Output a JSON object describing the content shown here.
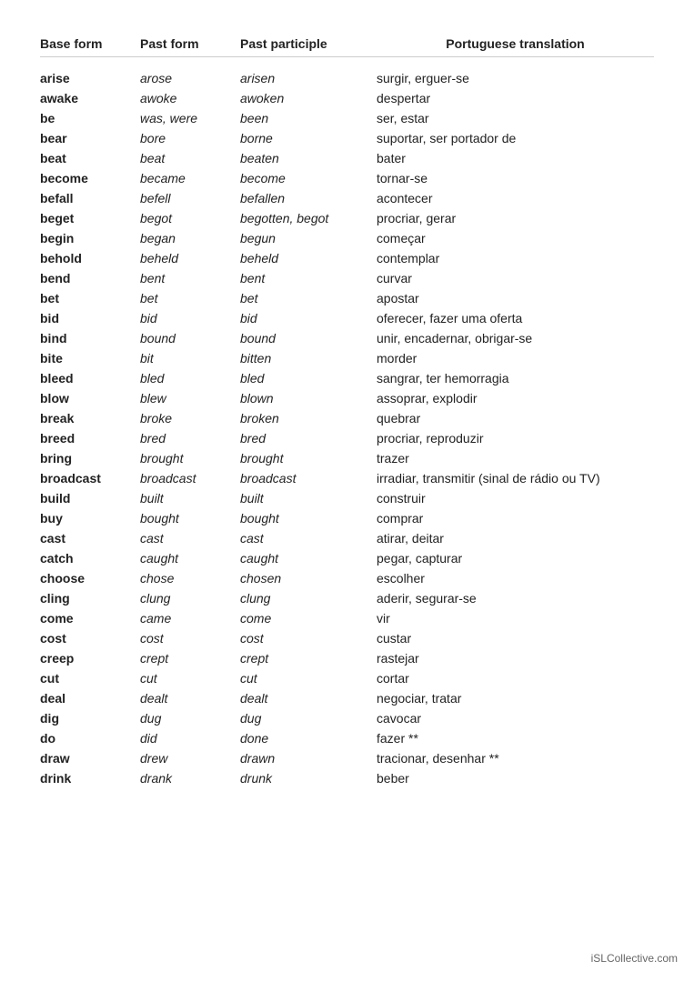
{
  "headers": {
    "base": "Base form",
    "past": "Past form",
    "pp": "Past participle",
    "pt": "Portuguese translation"
  },
  "rows": [
    {
      "base": "arise",
      "past": "arose",
      "pp": "arisen",
      "pt": "surgir, erguer-se"
    },
    {
      "base": "awake",
      "past": "awoke",
      "pp": "awoken",
      "pt": "despertar"
    },
    {
      "base": "be",
      "past": "was, were",
      "pp": "been",
      "pt": "ser, estar"
    },
    {
      "base": "bear",
      "past": "bore",
      "pp": "borne",
      "pt": "suportar, ser portador de"
    },
    {
      "base": "beat",
      "past": "beat",
      "pp": "beaten",
      "pt": "bater"
    },
    {
      "base": "become",
      "past": "became",
      "pp": "become",
      "pt": "tornar-se"
    },
    {
      "base": "befall",
      "past": "befell",
      "pp": "befallen",
      "pt": "acontecer"
    },
    {
      "base": "beget",
      "past": "begot",
      "pp": "begotten, begot",
      "pt": "procriar, gerar"
    },
    {
      "base": "begin",
      "past": "began",
      "pp": "begun",
      "pt": "começar"
    },
    {
      "base": "behold",
      "past": "beheld",
      "pp": "beheld",
      "pt": "contemplar"
    },
    {
      "base": "bend",
      "past": "bent",
      "pp": "bent",
      "pt": "curvar"
    },
    {
      "base": "bet",
      "past": "bet",
      "pp": "bet",
      "pt": "apostar"
    },
    {
      "base": "bid",
      "past": "bid",
      "pp": "bid",
      "pt": "oferecer, fazer uma oferta"
    },
    {
      "base": "bind",
      "past": "bound",
      "pp": "bound",
      "pt": "unir, encadernar, obrigar-se"
    },
    {
      "base": "bite",
      "past": "bit",
      "pp": "bitten",
      "pt": "morder"
    },
    {
      "base": "bleed",
      "past": "bled",
      "pp": "bled",
      "pt": "sangrar, ter hemorragia"
    },
    {
      "base": "blow",
      "past": "blew",
      "pp": "blown",
      "pt": "assoprar, explodir"
    },
    {
      "base": "break",
      "past": "broke",
      "pp": "broken",
      "pt": "quebrar"
    },
    {
      "base": "breed",
      "past": "bred",
      "pp": "bred",
      "pt": "procriar, reproduzir"
    },
    {
      "base": "bring",
      "past": "brought",
      "pp": "brought",
      "pt": "trazer"
    },
    {
      "base": "broadcast",
      "past": "broadcast",
      "pp": "broadcast",
      "pt": "irradiar, transmitir (sinal de rádio ou TV)"
    },
    {
      "base": "build",
      "past": "built",
      "pp": "built",
      "pt": "construir"
    },
    {
      "base": "buy",
      "past": "bought",
      "pp": "bought",
      "pt": "comprar"
    },
    {
      "base": "cast",
      "past": "cast",
      "pp": "cast",
      "pt": "atirar, deitar"
    },
    {
      "base": "catch",
      "past": "caught",
      "pp": "caught",
      "pt": "pegar, capturar"
    },
    {
      "base": "choose",
      "past": "chose",
      "pp": "chosen",
      "pt": "escolher"
    },
    {
      "base": "cling",
      "past": "clung",
      "pp": "clung",
      "pt": "aderir, segurar-se"
    },
    {
      "base": "come",
      "past": "came",
      "pp": "come",
      "pt": "vir"
    },
    {
      "base": "cost",
      "past": "cost",
      "pp": "cost",
      "pt": "custar"
    },
    {
      "base": "creep",
      "past": "crept",
      "pp": "crept",
      "pt": "rastejar"
    },
    {
      "base": "cut",
      "past": "cut",
      "pp": "cut",
      "pt": "cortar"
    },
    {
      "base": "deal",
      "past": "dealt",
      "pp": "dealt",
      "pt": "negociar, tratar"
    },
    {
      "base": "dig",
      "past": "dug",
      "pp": "dug",
      "pt": "cavocar"
    },
    {
      "base": "do",
      "past": "did",
      "pp": "done",
      "pt": "fazer **"
    },
    {
      "base": "draw",
      "past": "drew",
      "pp": "drawn",
      "pt": "tracionar, desenhar **"
    },
    {
      "base": "drink",
      "past": "drank",
      "pp": "drunk",
      "pt": "beber"
    }
  ],
  "watermark": "iSLCollective.com"
}
